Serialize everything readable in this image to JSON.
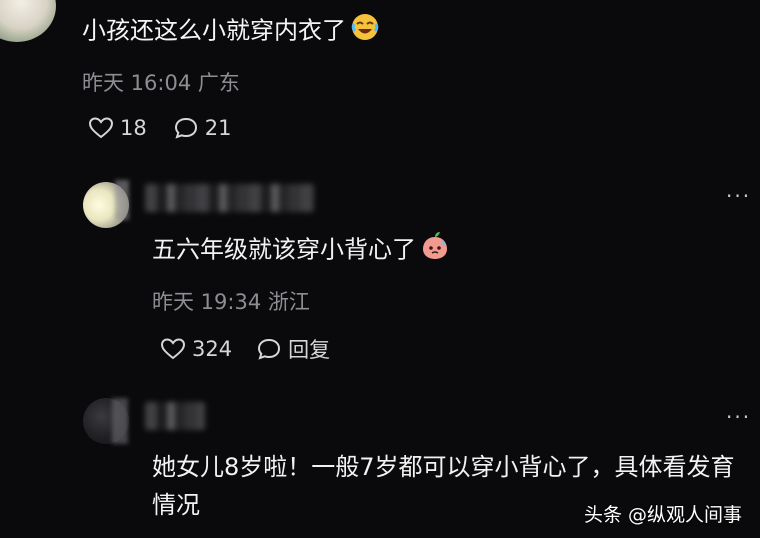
{
  "comment": {
    "text": "小孩还这么小就穿内衣了",
    "emoji": "laughing-tears-emoji",
    "meta": "昨天 16:04 广东",
    "likes": "18",
    "replies": "21"
  },
  "reply1": {
    "text": "五六年级就该穿小背心了",
    "emoji": "peach-sweat-emoji",
    "meta": "昨天 19:34 浙江",
    "likes": "324",
    "reply_label": "回复"
  },
  "reply2": {
    "text": "她女儿8岁啦！一般7岁都可以穿小背心了，具体看发育情况"
  },
  "more_label": "···",
  "watermark": "头条 @纵观人间事",
  "colors": {
    "background": "#0a0a0c",
    "text": "#f2f2f2",
    "meta": "#8d8d93"
  }
}
